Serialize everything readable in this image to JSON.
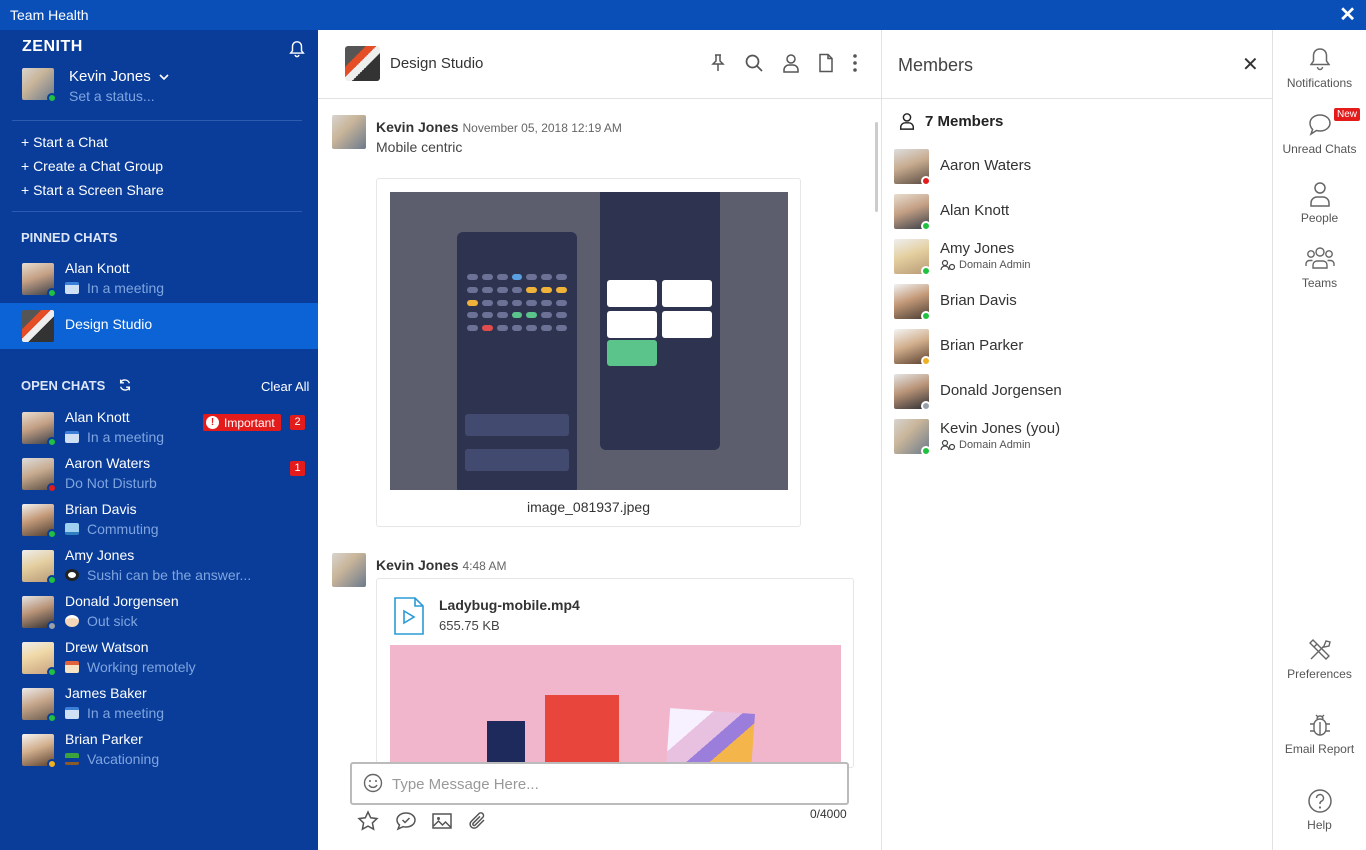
{
  "window": {
    "title": "Team Health",
    "close_glyph": "✕"
  },
  "sidebar": {
    "brand": "ZENITH",
    "user": {
      "name": "Kevin Jones",
      "status_placeholder": "Set a status..."
    },
    "actions": [
      "+ Start a Chat",
      "+ Create a Chat Group",
      "+ Start a Screen Share"
    ],
    "pinned_title": "PINNED CHATS",
    "pinned": [
      {
        "name": "Alan Knott",
        "sub": "In a meeting"
      },
      {
        "name": "Design Studio"
      }
    ],
    "open_title": "OPEN CHATS",
    "clear_all": "Clear All",
    "important_label": "Important",
    "open": [
      {
        "name": "Alan Knott",
        "sub": "In a meeting",
        "count": "2"
      },
      {
        "name": "Aaron Waters",
        "sub": "Do Not Disturb",
        "count": "1"
      },
      {
        "name": "Brian Davis",
        "sub": "Commuting"
      },
      {
        "name": "Amy Jones",
        "sub": "Sushi can be the answer..."
      },
      {
        "name": "Donald Jorgensen",
        "sub": "Out sick"
      },
      {
        "name": "Drew Watson",
        "sub": "Working remotely"
      },
      {
        "name": "James Baker",
        "sub": "In a meeting"
      },
      {
        "name": "Brian Parker",
        "sub": "Vacationing"
      }
    ]
  },
  "main": {
    "chat_title": "Design Studio",
    "messages": [
      {
        "author": "Kevin Jones",
        "time": "November 05, 2018 12:19 AM",
        "text": "Mobile centric",
        "image_caption": "image_081937.jpeg"
      },
      {
        "author": "Kevin Jones",
        "time": "4:48 AM",
        "file_name": "Ladybug-mobile.mp4",
        "file_size": "655.75 KB"
      }
    ],
    "composer": {
      "placeholder": "Type Message Here...",
      "char_count": "0/4000"
    }
  },
  "members": {
    "title": "Members",
    "count_label": "7 Members",
    "list": [
      {
        "name": "Aaron Waters",
        "role": ""
      },
      {
        "name": "Alan Knott",
        "role": ""
      },
      {
        "name": "Amy Jones",
        "role": "Domain Admin"
      },
      {
        "name": "Brian Davis",
        "role": ""
      },
      {
        "name": "Brian Parker",
        "role": ""
      },
      {
        "name": "Donald Jorgensen",
        "role": ""
      },
      {
        "name": "Kevin Jones (you)",
        "role": "Domain Admin"
      }
    ]
  },
  "rail": {
    "items": [
      "Notifications",
      "Unread Chats",
      "People",
      "Teams",
      "Preferences",
      "Email Report",
      "Help"
    ],
    "new_badge": "New"
  },
  "colors": {
    "sidebar": "#0a3d99",
    "titlebar": "#0a4fb8",
    "active_chat": "#0b63d6",
    "status_online": "#20c040",
    "status_dnd": "#e31b1b",
    "status_away": "#f0b020",
    "status_offline": "#9aa0a8"
  }
}
